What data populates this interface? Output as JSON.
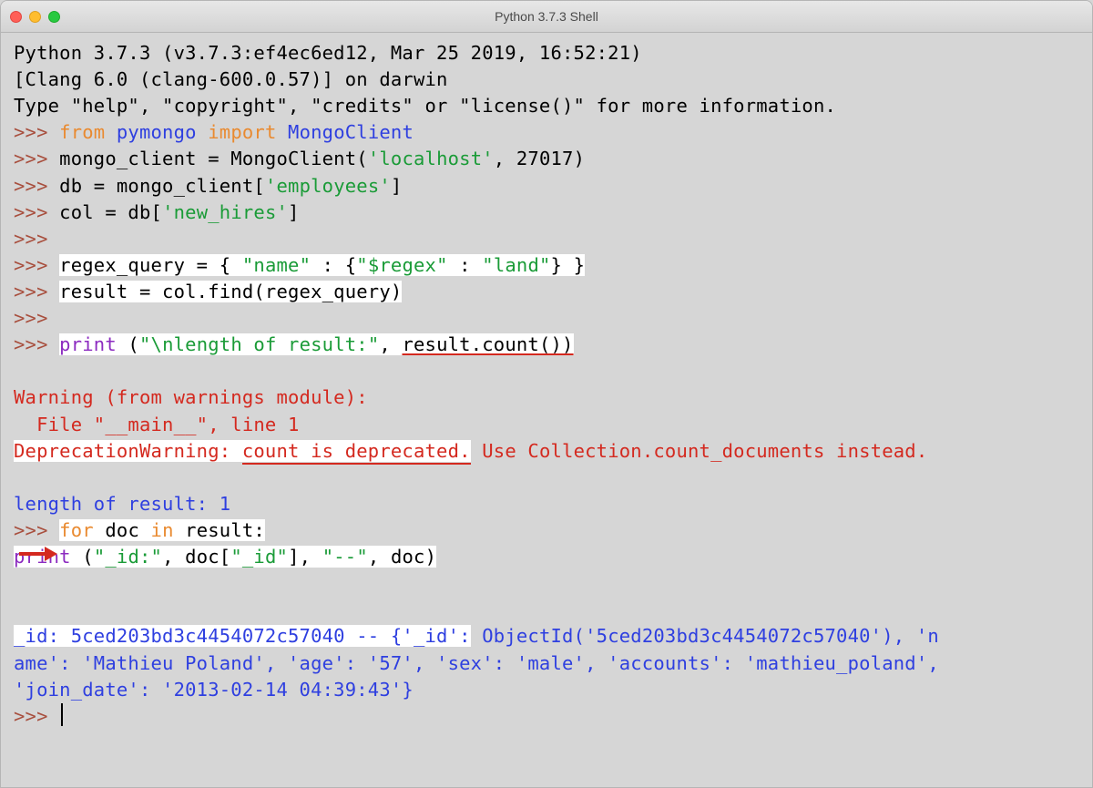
{
  "window": {
    "title": "Python 3.7.3 Shell"
  },
  "banner": {
    "l1": "Python 3.7.3 (v3.7.3:ef4ec6ed12, Mar 25 2019, 16:52:21) ",
    "l2": "[Clang 6.0 (clang-600.0.57)] on darwin",
    "l3": "Type \"help\", \"copyright\", \"credits\" or \"license()\" for more information."
  },
  "prompt": ">>> ",
  "code": {
    "kw_from": "from",
    "kw_import": "import",
    "kw_for": "for",
    "kw_in": "in",
    "mod_pymongo": "pymongo",
    "mod_mongoclient": "MongoClient",
    "line2a": "mongo_client = MongoClient(",
    "str_localhost": "'localhost'",
    "line2b": ", 27017)",
    "line3a": "db = mongo_client[",
    "str_employees": "'employees'",
    "line3b": "]",
    "line4a": "col = db[",
    "str_newhires": "'new_hires'",
    "line4b": "]",
    "line5a": "regex_query = { ",
    "str_name": "\"name\"",
    "line5b": " : {",
    "str_regex": "\"$regex\"",
    "line5c": " : ",
    "str_land": "\"land\"",
    "line5d": "} }",
    "line6": "result = col.find(regex_query)",
    "builtin_print": "print",
    "line7a": " (",
    "str_lenres": "\"\\nlength of result:\"",
    "line7b": ", ",
    "line7c": "result.count())",
    "line8a": " doc ",
    "line8b": " result:",
    "line9a": " (",
    "str_id": "\"_id:\"",
    "line9b": ", doc[",
    "str_idkey": "\"_id\"",
    "line9c": "], ",
    "str_dashdash": "\"--\"",
    "line9d": ", doc)"
  },
  "warn": {
    "l1": "Warning (from warnings module):",
    "l2": "  File \"__main__\", line 1",
    "l3a": "DeprecationWarning: ",
    "l3b": "count is deprecated.",
    "l3c": " Use Collection.count_documents instead."
  },
  "out": {
    "len": "length of result: 1",
    "doc1a": "_id: 5ced203bd3c4454072c57040 -- {'_id':",
    "doc1b": " ObjectId('5ced203bd3c4454072c57040'), 'n",
    "doc2": "ame': 'Mathieu Poland', 'age': '57', 'sex': 'male', 'accounts': 'mathieu_poland', ",
    "doc3": "'join_date': '2013-02-14 04:39:43'}"
  }
}
